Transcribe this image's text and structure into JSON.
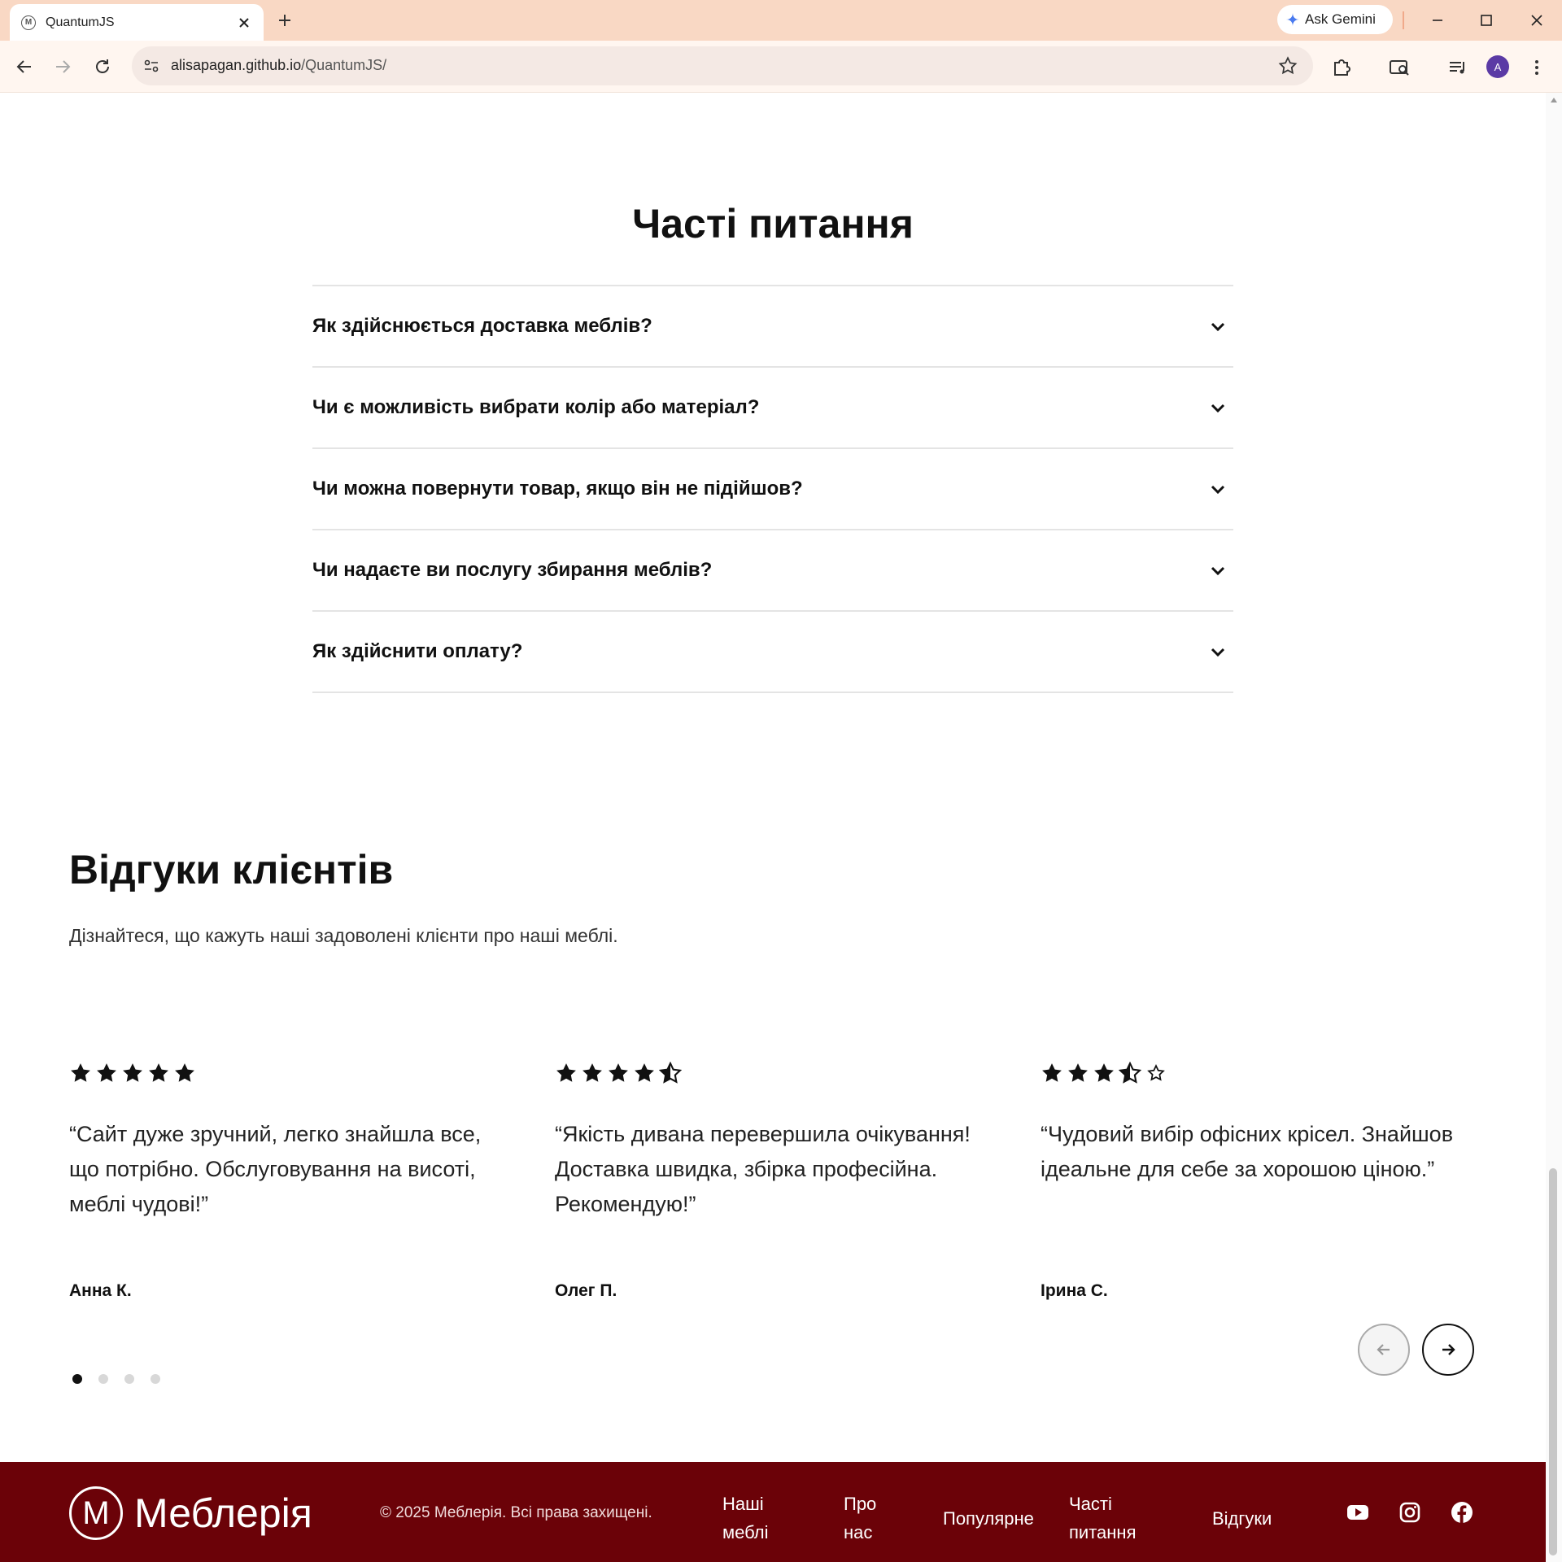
{
  "browser": {
    "tab_title": "QuantumJS",
    "favicon_letter": "M",
    "gemini_label": "Ask Gemini",
    "url_host": "alisapagan.github.io",
    "url_path": "/QuantumJS/",
    "profile_initial": "A"
  },
  "faq": {
    "title": "Часті питання",
    "items": [
      {
        "question": "Як здійснюється доставка меблів?"
      },
      {
        "question": "Чи є можливість вибрати колір або матеріал?"
      },
      {
        "question": "Чи можна повернути товар, якщо він не підійшов?"
      },
      {
        "question": "Чи надаєте ви послугу збирання меблів?"
      },
      {
        "question": "Як здійснити оплату?"
      }
    ]
  },
  "reviews": {
    "title": "Відгуки клієнтів",
    "subtitle": "Дізнайтеся, що кажуть наші задоволені клієнти про наші меблі.",
    "items": [
      {
        "rating": 5,
        "quote": "“Сайт дуже зручний, легко знайшла все, що потрібно. Обслуговування на висоті, меблі чудові!”",
        "author": "Анна К."
      },
      {
        "rating": 4.5,
        "quote": "“Якість дивана перевершила очікування! Доставка швидка, збірка професійна. Рекомендую!”",
        "author": "Олег П."
      },
      {
        "rating": 3.5,
        "quote": "“Чудовий вибір офісних крісел. Знайшов ідеальне для себе за хорошою ціною.”",
        "author": "Ірина С."
      }
    ],
    "pagination": {
      "total": 4,
      "active": 1
    }
  },
  "footer": {
    "logo_letter": "M",
    "logo_text": "Меблерія",
    "copyright": "© 2025 Меблерія. Всі права захищені.",
    "nav": [
      {
        "label": "Наші меблі"
      },
      {
        "label": "Про нас"
      },
      {
        "label": "Популярне"
      },
      {
        "label": "Часті питання"
      },
      {
        "label": "Відгуки"
      }
    ],
    "social": [
      "youtube-icon",
      "instagram-icon",
      "facebook-icon"
    ]
  },
  "colors": {
    "footer_bg": "#6b0208",
    "tabbar_bg": "#f9d8c4"
  }
}
